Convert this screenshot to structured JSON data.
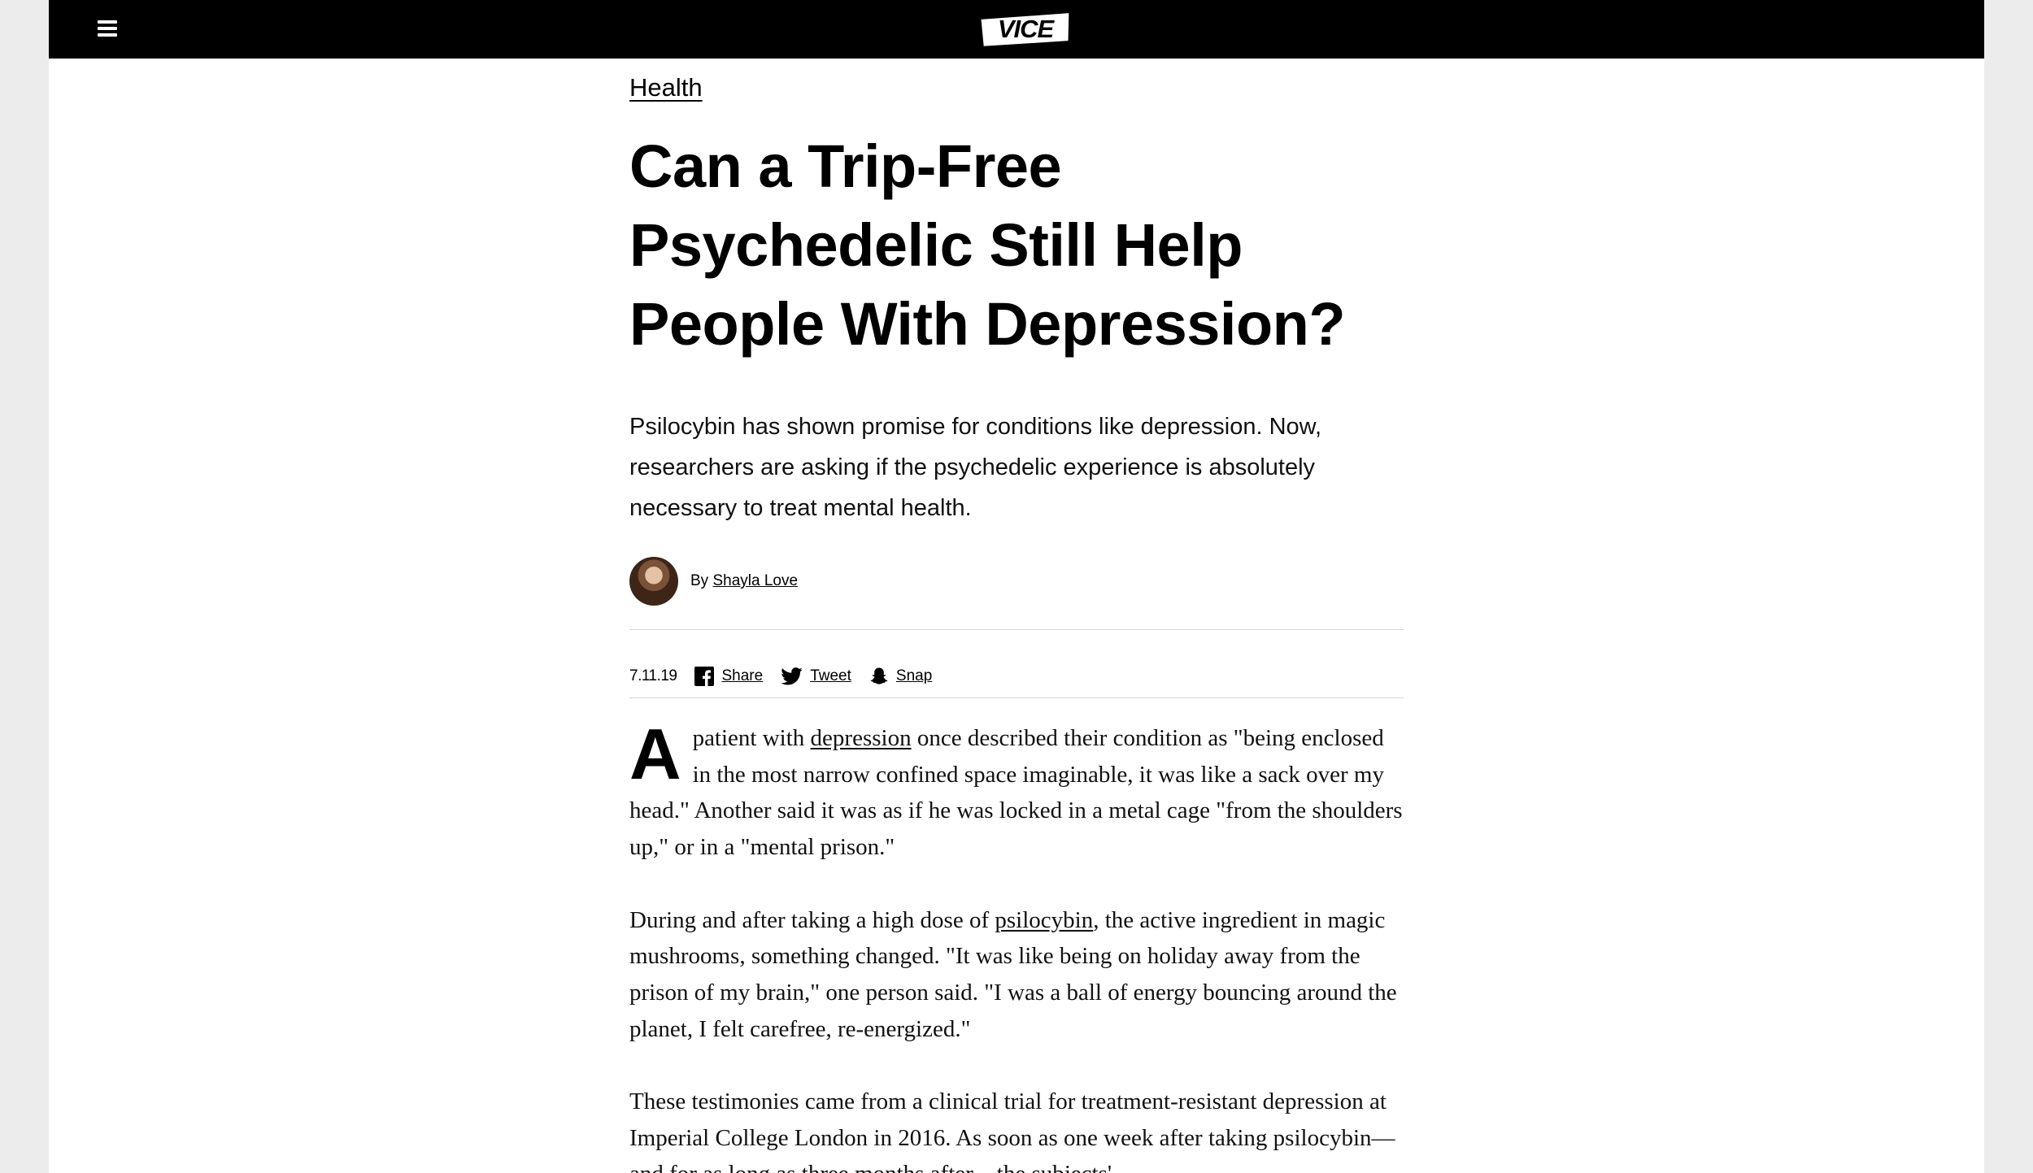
{
  "topbar": {
    "logo_text": "VICE",
    "menu_icon": "hamburger-menu-icon"
  },
  "article": {
    "category": "Health",
    "headline": "Can a Trip-Free Psychedelic Still Help People With Depression?",
    "dek": "Psilocybin has shown promise for conditions like depression. Now, researchers are asking if the psychedelic experience is absolutely necessary to treat mental health.",
    "byline_prefix": "By",
    "author": "Shayla Love",
    "date": "7.11.19",
    "share": [
      {
        "label": "Share",
        "icon": "facebook-icon"
      },
      {
        "label": "Tweet",
        "icon": "twitter-icon"
      },
      {
        "label": "Snap",
        "icon": "snapchat-icon"
      }
    ],
    "body": {
      "p1_dropcap": "A",
      "p1_a": "patient with ",
      "p1_link": "depression",
      "p1_b": " once described their condition as \"being enclosed in the most narrow confined space imaginable, it was like a sack over my head.\" Another said it was as if he was locked in a metal cage \"from the shoulders up,\" or in a \"mental prison.\"",
      "p2_a": "During and after taking a high dose of ",
      "p2_link": "psilocybin",
      "p2_b": ", the active ingredient in magic mushrooms, something changed. \"It was like being on holiday away from the prison of my brain,\" one person said. \"I was a ball of energy bouncing around the planet, I felt carefree, re-energized.\"",
      "p3": "These testimonies came from a clinical trial for treatment-resistant depression at Imperial College London in 2016. As soon as one week after taking psilocybin—and for as long as three months after—the subjects'"
    }
  },
  "colors": {
    "topbar_bg": "#000000",
    "page_bg": "#ffffff",
    "outer_bg": "#ececec",
    "text": "#111111",
    "rule": "#d6d6d6"
  }
}
